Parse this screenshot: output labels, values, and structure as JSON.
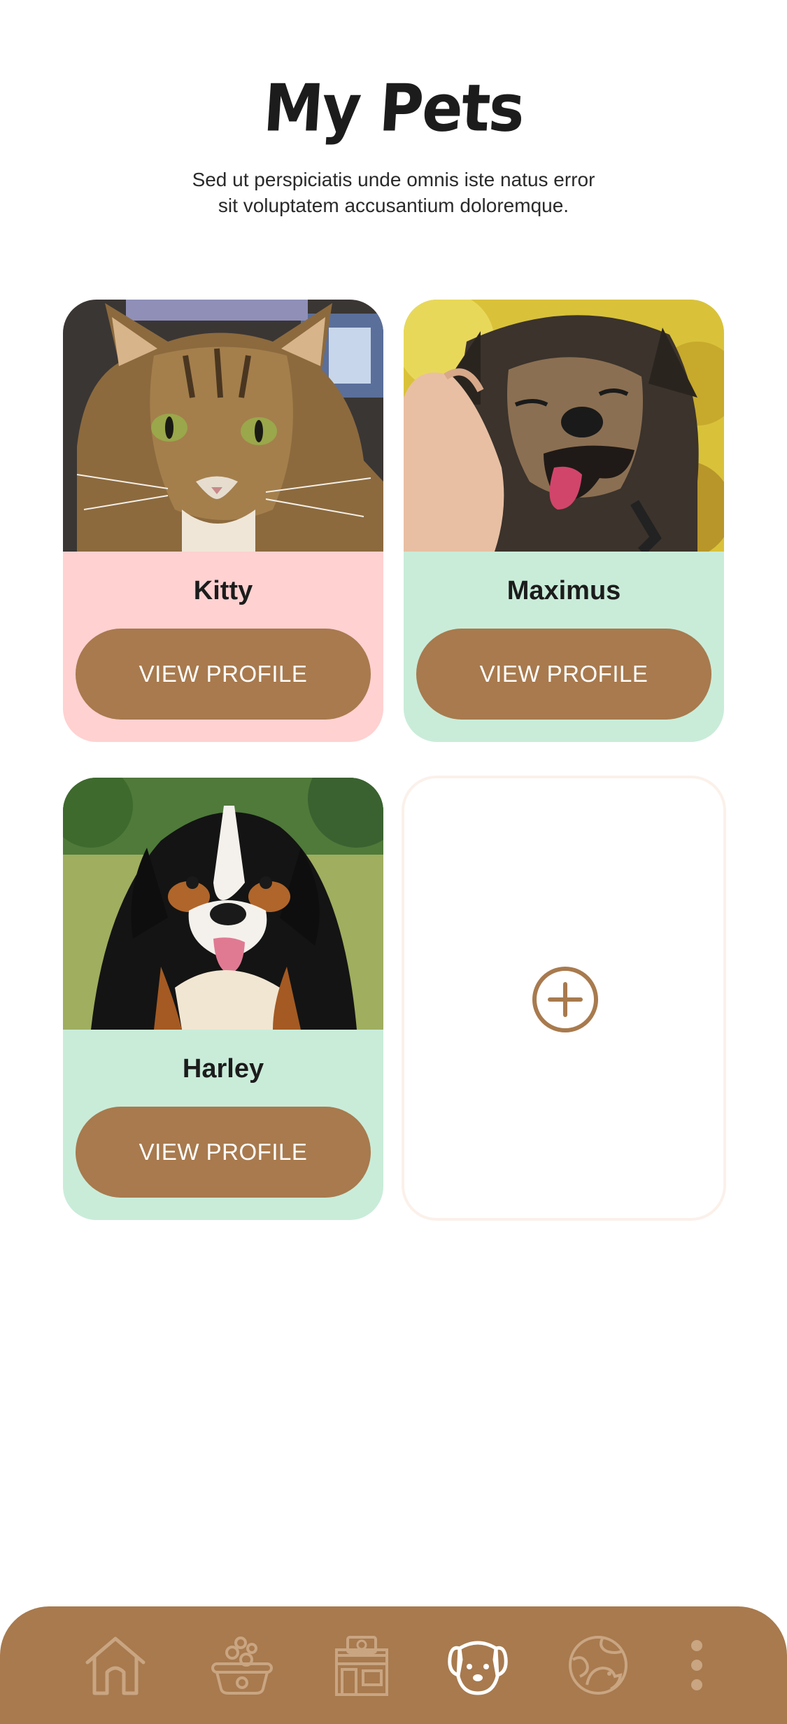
{
  "page": {
    "title": "My Pets",
    "subtitle_line1": "Sed ut perspiciatis unde omnis iste natus error",
    "subtitle_line2": "sit voluptatem accusantium doloremque."
  },
  "pets": [
    {
      "name": "Kitty",
      "button_label": "VIEW PROFILE",
      "card_color": "#ffd1d1",
      "photo": "tabby-cat"
    },
    {
      "name": "Maximus",
      "button_label": "VIEW PROFILE",
      "card_color": "#c9ecd9",
      "photo": "happy-dog"
    },
    {
      "name": "Harley",
      "button_label": "VIEW PROFILE",
      "card_color": "#c9ecd9",
      "photo": "bernese-mountain-dog"
    }
  ],
  "add_card": {
    "icon": "plus-circle-icon"
  },
  "colors": {
    "accent": "#a87a4e",
    "pink_card": "#ffd1d1",
    "mint_card": "#c9ecd9",
    "nav_icon": "#c9a582",
    "nav_icon_active": "#ffffff"
  },
  "nav": {
    "items": [
      {
        "icon": "home-icon",
        "active": false
      },
      {
        "icon": "pet-grooming-icon",
        "active": false
      },
      {
        "icon": "pet-store-icon",
        "active": false
      },
      {
        "icon": "dog-face-icon",
        "active": true
      },
      {
        "icon": "pet-globe-icon",
        "active": false
      },
      {
        "icon": "more-vertical-icon",
        "active": false
      }
    ]
  }
}
